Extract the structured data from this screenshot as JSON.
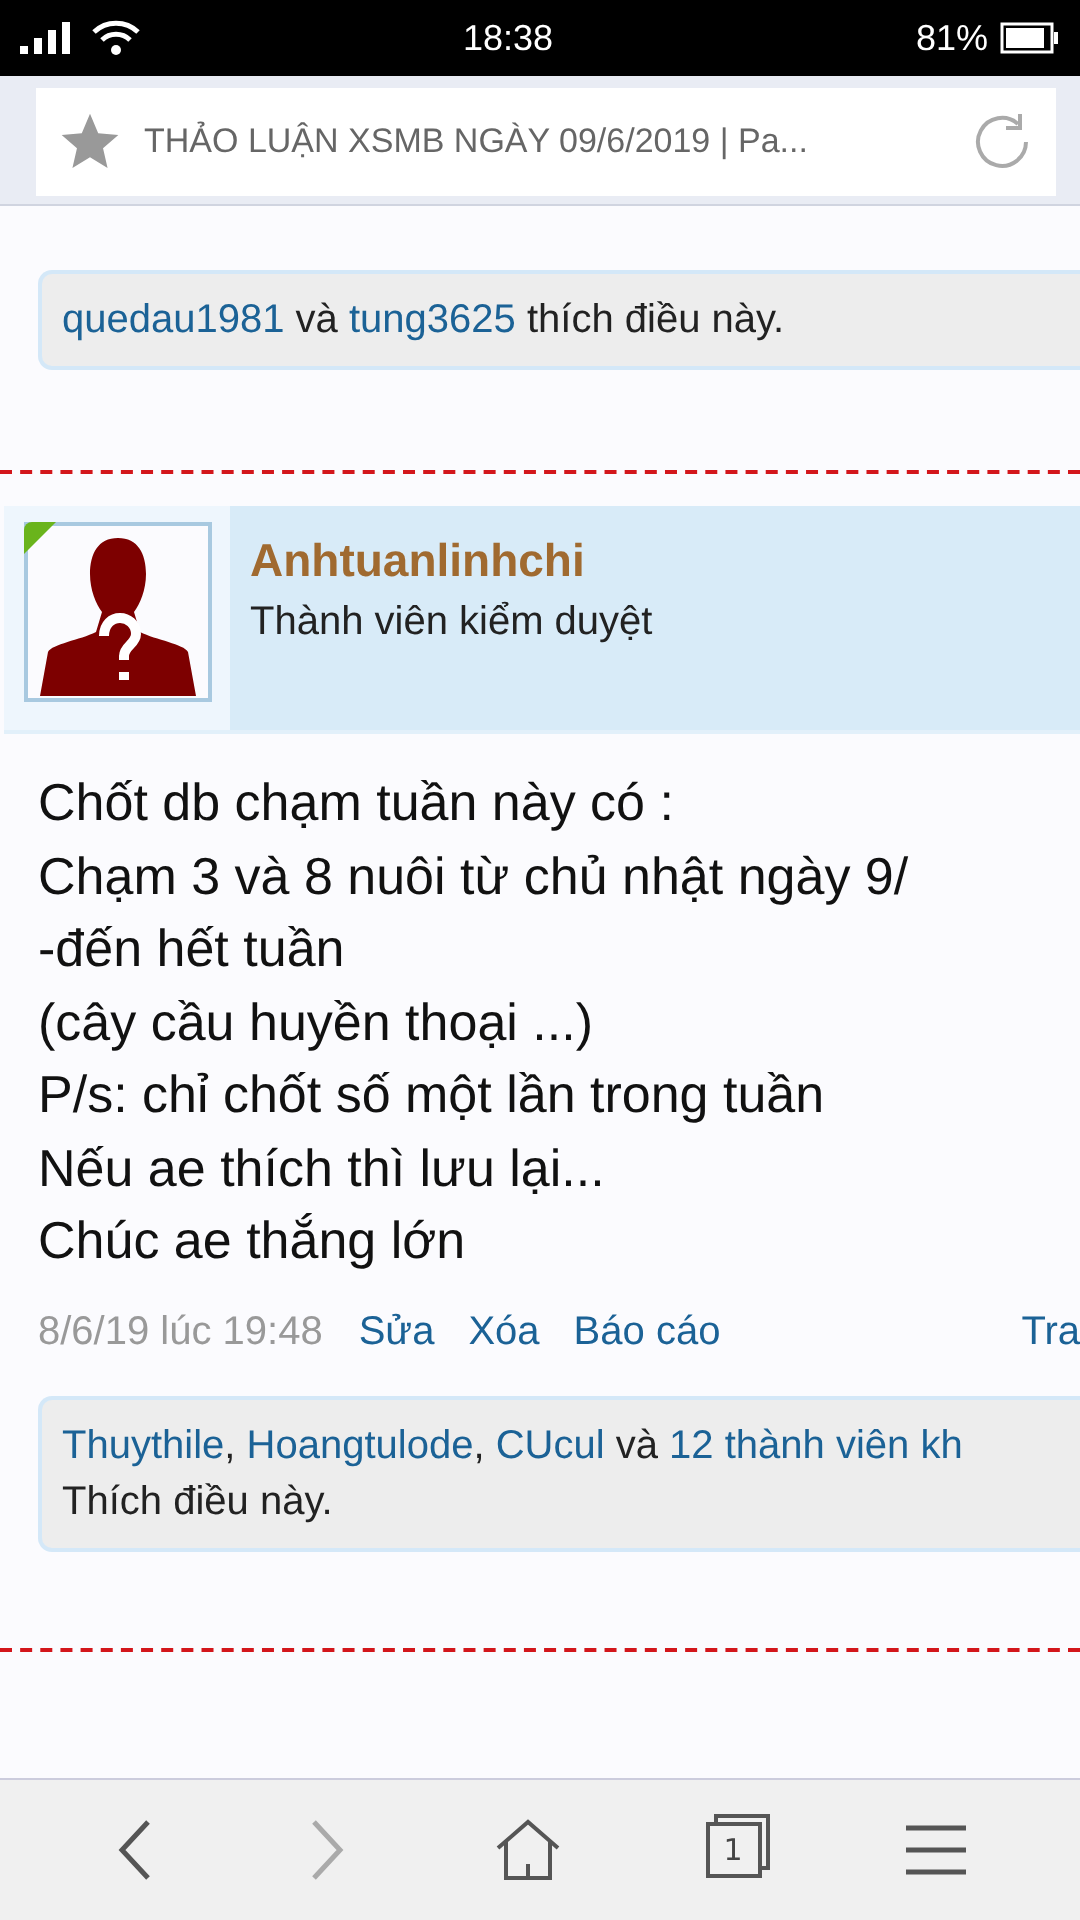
{
  "status_bar": {
    "time": "18:38",
    "battery": "81%"
  },
  "address_bar": {
    "title": "THẢO LUẬN XSMB NGÀY 09/6/2019 | Pa..."
  },
  "previous_post": {
    "likes": [
      {
        "text": "quedau1981",
        "kind": "link"
      },
      {
        "text": " và ",
        "kind": "plain"
      },
      {
        "text": "tung3625",
        "kind": "link"
      },
      {
        "text": " thích điều này.",
        "kind": "plain"
      }
    ]
  },
  "post": {
    "author": "Anhtuanlinhchi",
    "role": "Thành viên kiểm duyệt",
    "online": true,
    "lines": [
      "Chốt db chạm tuần này có :",
      "Chạm 3 và 8 nuôi từ chủ nhật ngày 9/",
      "-đến hết tuần",
      "(cây cầu huyền thoại ...)",
      "P/s: chỉ chốt số một lần trong tuần",
      "Nếu ae thích thì lưu lại...",
      "Chúc ae thắng lớn"
    ],
    "date": "8/6/19 lúc 19:48",
    "actions": [
      "Sửa",
      "Xóa",
      "Báo cáo"
    ],
    "reply": "Tra",
    "likes": [
      {
        "text": "Thuythile",
        "kind": "link"
      },
      {
        "text": ", ",
        "kind": "plain"
      },
      {
        "text": "Hoangtulode",
        "kind": "link"
      },
      {
        "text": ", ",
        "kind": "plain"
      },
      {
        "text": "CUcul",
        "kind": "link"
      },
      {
        "text": " và ",
        "kind": "plain"
      },
      {
        "text": "12 thành viên kh",
        "kind": "link"
      }
    ],
    "likes_line2": "Thích điều này."
  },
  "nav": {
    "forward_disabled": true,
    "tab_count": "1"
  }
}
